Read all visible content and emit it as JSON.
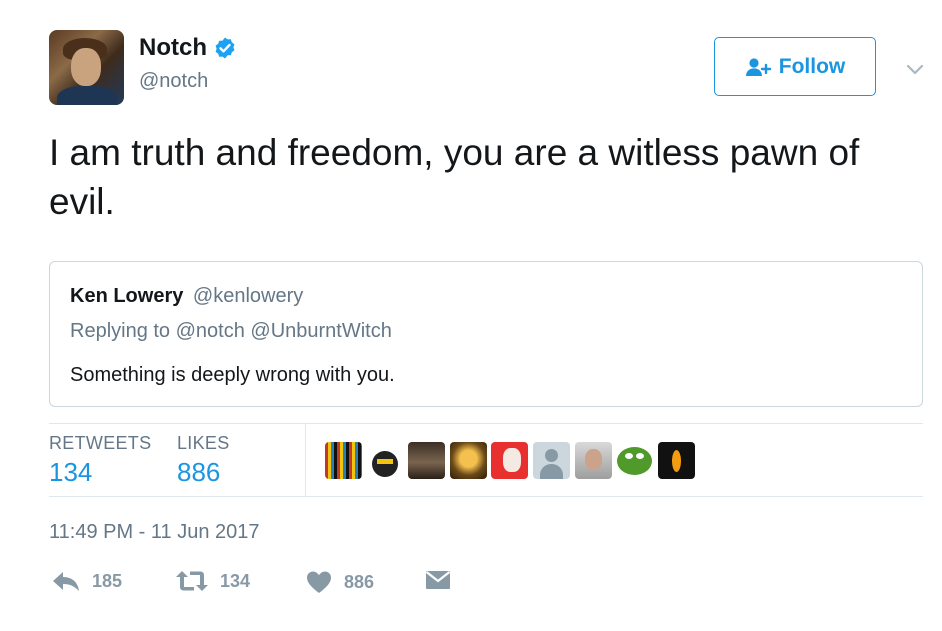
{
  "author": {
    "name": "Notch",
    "handle": "@notch",
    "verified": true,
    "avatar_icon": "user-avatar-photo"
  },
  "follow_button": {
    "label": "Follow",
    "icon": "follow-user-icon"
  },
  "menu_icon": "chevron-down-icon",
  "tweet": {
    "text": "I am truth and freedom, you are a witless pawn of evil."
  },
  "quoted_tweet": {
    "author_name": "Ken Lowery",
    "author_handle": "@kenlowery",
    "replying_to": "Replying to @notch @UnburntWitch",
    "text": "Something is deeply wrong with you."
  },
  "stats": {
    "retweets_label": "RETWEETS",
    "retweets_value": "134",
    "likes_label": "LIKES",
    "likes_value": "886"
  },
  "likers": [
    {
      "name": "liker-1"
    },
    {
      "name": "liker-2"
    },
    {
      "name": "liker-3"
    },
    {
      "name": "liker-4"
    },
    {
      "name": "liker-5"
    },
    {
      "name": "liker-6"
    },
    {
      "name": "liker-7"
    },
    {
      "name": "liker-8"
    },
    {
      "name": "liker-9"
    }
  ],
  "timestamp": "11:49 PM - 11 Jun 2017",
  "actions": {
    "reply_count": "185",
    "retweet_count": "134",
    "like_count": "886"
  },
  "colors": {
    "accent": "#1b95e0",
    "muted": "#657786",
    "icon_gray": "#8899a6",
    "border": "#e1e8ed"
  }
}
